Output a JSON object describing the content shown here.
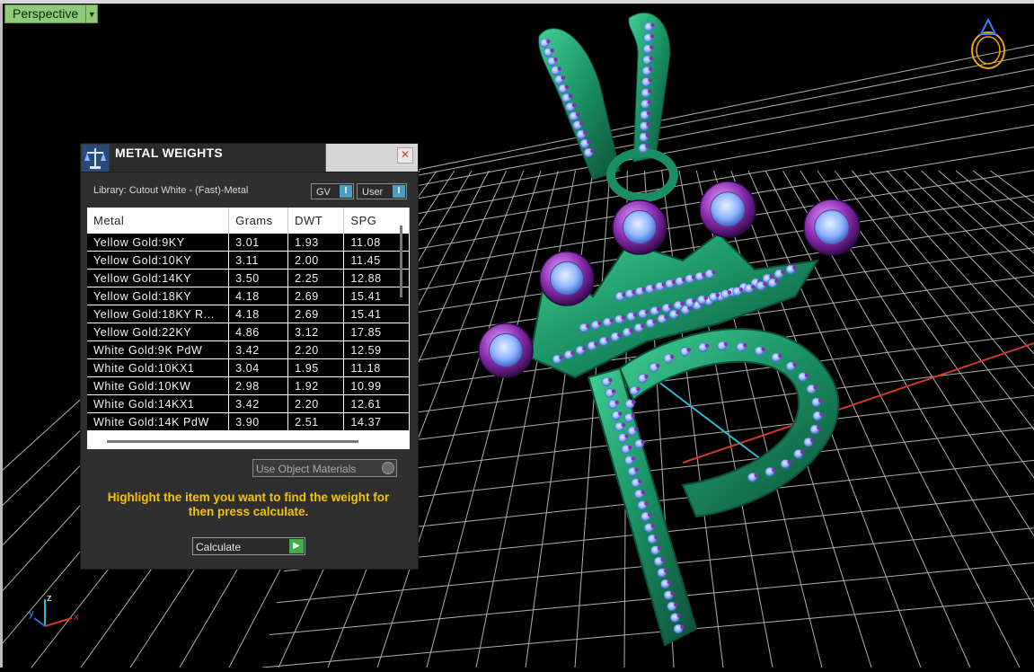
{
  "viewport": {
    "view_name": "Perspective"
  },
  "panel": {
    "title": "METAL WEIGHTS",
    "close_label": "✕",
    "library_label": "Library: Cutout White - (Fast)-Metal",
    "unit_select": "GV",
    "user_select": "User",
    "columns": [
      "Metal",
      "Grams",
      "DWT",
      "SPG"
    ],
    "rows": [
      [
        "Yellow Gold:9KY",
        "3.01",
        "1.93",
        "11.08"
      ],
      [
        "Yellow Gold:10KY",
        "3.11",
        "2.00",
        "11.45"
      ],
      [
        "Yellow Gold:14KY",
        "3.50",
        "2.25",
        "12.88"
      ],
      [
        "Yellow Gold:18KY",
        "4.18",
        "2.69",
        "15.41"
      ],
      [
        "Yellow Gold:18KY R...",
        "4.18",
        "2.69",
        "15.41"
      ],
      [
        "Yellow Gold:22KY",
        "4.86",
        "3.12",
        "17.85"
      ],
      [
        "White Gold:9K PdW",
        "3.42",
        "2.20",
        "12.59"
      ],
      [
        "White Gold:10KX1",
        "3.04",
        "1.95",
        "11.18"
      ],
      [
        "White Gold:10KW",
        "2.98",
        "1.92",
        "10.99"
      ],
      [
        "White Gold:14KX1",
        "3.42",
        "2.20",
        "12.61"
      ],
      [
        "White Gold:14K PdW",
        "3.90",
        "2.51",
        "14.37"
      ]
    ],
    "use_object_materials": "Use Object Materials",
    "hint": "Highlight the item you want to find the weight for then press calculate.",
    "calculate_label": "Calculate"
  },
  "axes": {
    "x": "x",
    "y": "y",
    "z": "z"
  },
  "colors": {
    "metal": "#1f8a62",
    "gem": "#8fb4ff",
    "prong": "#8a2bb0",
    "hint": "#f5c400",
    "grid": "#cfcfcf"
  }
}
